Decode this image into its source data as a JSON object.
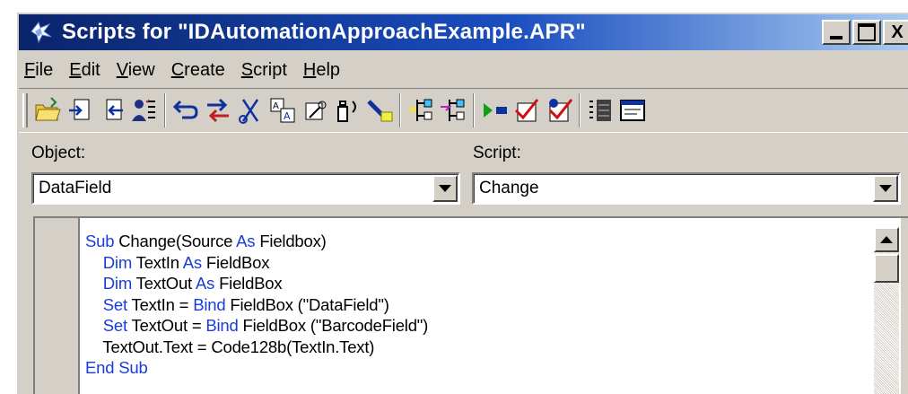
{
  "window": {
    "title": "Scripts for \"IDAutomationApproachExample.APR\"",
    "title_gradient_start": "#0a246a",
    "face_color": "#d4d0c8"
  },
  "caption_buttons": {
    "close_label": "X"
  },
  "menu": [
    {
      "accel": "F",
      "rest": "ile"
    },
    {
      "accel": "E",
      "rest": "dit"
    },
    {
      "accel": "V",
      "rest": "iew"
    },
    {
      "accel": "C",
      "rest": "reate"
    },
    {
      "accel": "S",
      "rest": "cript"
    },
    {
      "accel": "H",
      "rest": "elp"
    }
  ],
  "toolbar_icons": [
    "open-folder-icon",
    "export-icon",
    "import-icon",
    "user-checklist-icon",
    "undo-arrow-icon",
    "swap-arrows-icon",
    "cut-scissors-icon",
    "find-text-icon",
    "replace-icon",
    "browse-icon",
    "highlight-pen-icon",
    "breakpoint-icon",
    "step-icon",
    "run-icon",
    "check-icon",
    "check-all-icon",
    "outline-icon",
    "window-icon"
  ],
  "object": {
    "label": "Object:",
    "value": "DataField"
  },
  "script": {
    "label": "Script:",
    "value": "Change"
  },
  "code": {
    "keyword_color": "#1a3dd9",
    "lines": [
      [
        {
          "t": "Sub",
          "kw": true
        },
        {
          "t": " Change(Source "
        },
        {
          "t": "As",
          "kw": true
        },
        {
          "t": " Fieldbox)"
        }
      ],
      [
        {
          "t": "    "
        },
        {
          "t": "Dim",
          "kw": true
        },
        {
          "t": " TextIn "
        },
        {
          "t": "As",
          "kw": true
        },
        {
          "t": " FieldBox"
        }
      ],
      [
        {
          "t": "    "
        },
        {
          "t": "Dim",
          "kw": true
        },
        {
          "t": " TextOut "
        },
        {
          "t": "As",
          "kw": true
        },
        {
          "t": " FieldBox"
        }
      ],
      [
        {
          "t": "    "
        },
        {
          "t": "Set",
          "kw": true
        },
        {
          "t": " TextIn = "
        },
        {
          "t": "Bind",
          "kw": true
        },
        {
          "t": " FieldBox (\"DataField\")"
        }
      ],
      [
        {
          "t": "    "
        },
        {
          "t": "Set",
          "kw": true
        },
        {
          "t": " TextOut = "
        },
        {
          "t": "Bind",
          "kw": true
        },
        {
          "t": " FieldBox (\"BarcodeField\")"
        }
      ],
      [
        {
          "t": "    TextOut.Text = Code128b(TextIn.Text)"
        }
      ],
      [
        {
          "t": "End Sub",
          "kw": true
        }
      ]
    ]
  }
}
